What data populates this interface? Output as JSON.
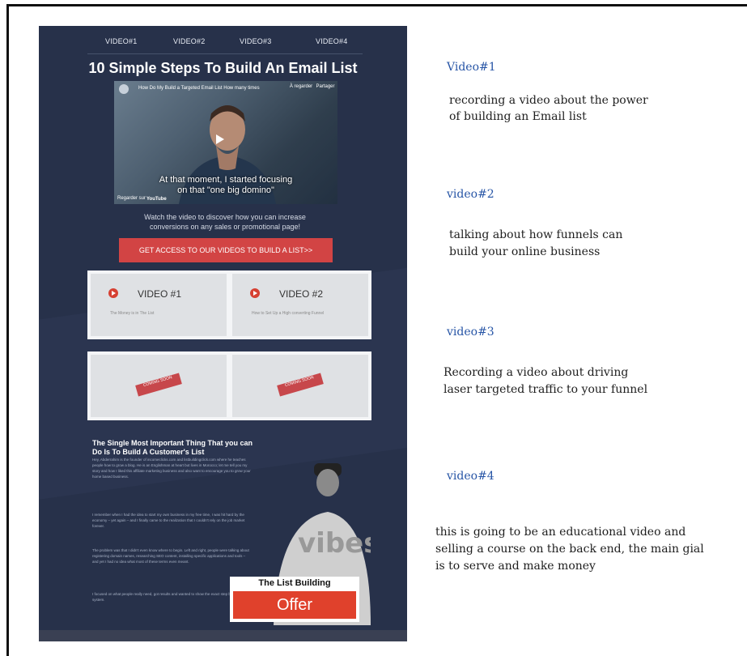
{
  "nav": {
    "items": [
      "VIDEO#1",
      "VIDEO#2",
      "VIDEO#3",
      "VIDEO#4"
    ]
  },
  "title": "10 Simple Steps To Build An Email List",
  "video": {
    "title": "How Do My Build a Targeted Email List How many times",
    "watch_later": "À regarder",
    "share": "Partager",
    "caption_line1": "At that moment, I started focusing",
    "caption_line2": "on that \"one big domino\"",
    "watch_on": "Regarder sur",
    "platform": "YouTube"
  },
  "subtitle": "Watch the video to discover how you can increase conversions on any sales or promotional page!",
  "cta_label": "GET ACCESS TO OUR VIDEOS TO BUILD A LIST>>",
  "cards": [
    {
      "label": "VIDEO #1",
      "sub": "The Money is in The List"
    },
    {
      "label": "VIDEO #2",
      "sub": "How to Set Up a High converting Funnel"
    },
    {
      "ribbon": "COMING SOON"
    },
    {
      "ribbon": "COMING SOON"
    }
  ],
  "about": {
    "title": "The Single Most Important Thing That you can Do Is To Build A Customer's List",
    "p1": "Hey, Abderrahim is the founder of incomeclicks.com and listbuildingclick.com where he teaches people how to grow a blog. He is an Englishman at heart but lives in Morocco; let me tell you my story and how I liked this affiliate marketing business and also want to encourage you to grow your home based business.",
    "p2": "I remember when I had the idea to start my own business in my free time, I was hit hard by the economy – yet again – and I finally came to the realization that I couldn't rely on the job market forever.",
    "p3": "The problem was that I didn't even know where to begin. Left and right, people were talking about registering domain names, researching SEO content, installing specific applications and tools – and yet I had no idea what most of these terms even meant.",
    "p4": "I focused on what people really need, got results and wanted to show the exact step by step system."
  },
  "offer": {
    "top": "The List Building",
    "button": "Offer"
  },
  "notes": [
    {
      "head": "Video#1",
      "text": [
        "recording a video about the power",
        "of building an Email list"
      ]
    },
    {
      "head": "video#2",
      "text": [
        "talking about how funnels can",
        "build your online business"
      ]
    },
    {
      "head": "video#3",
      "text": [
        "Recording a video about driving",
        "laser targeted traffic to your funnel"
      ]
    },
    {
      "head": "video#4",
      "text": [
        "this is going to be an educational video and",
        "selling a course on the back end, the main gial",
        "is to serve and make money"
      ]
    }
  ],
  "colors": {
    "panel_bg": "#27314a",
    "cta": "#d24444",
    "note_head": "#2755a6",
    "offer": "#e0412c"
  }
}
